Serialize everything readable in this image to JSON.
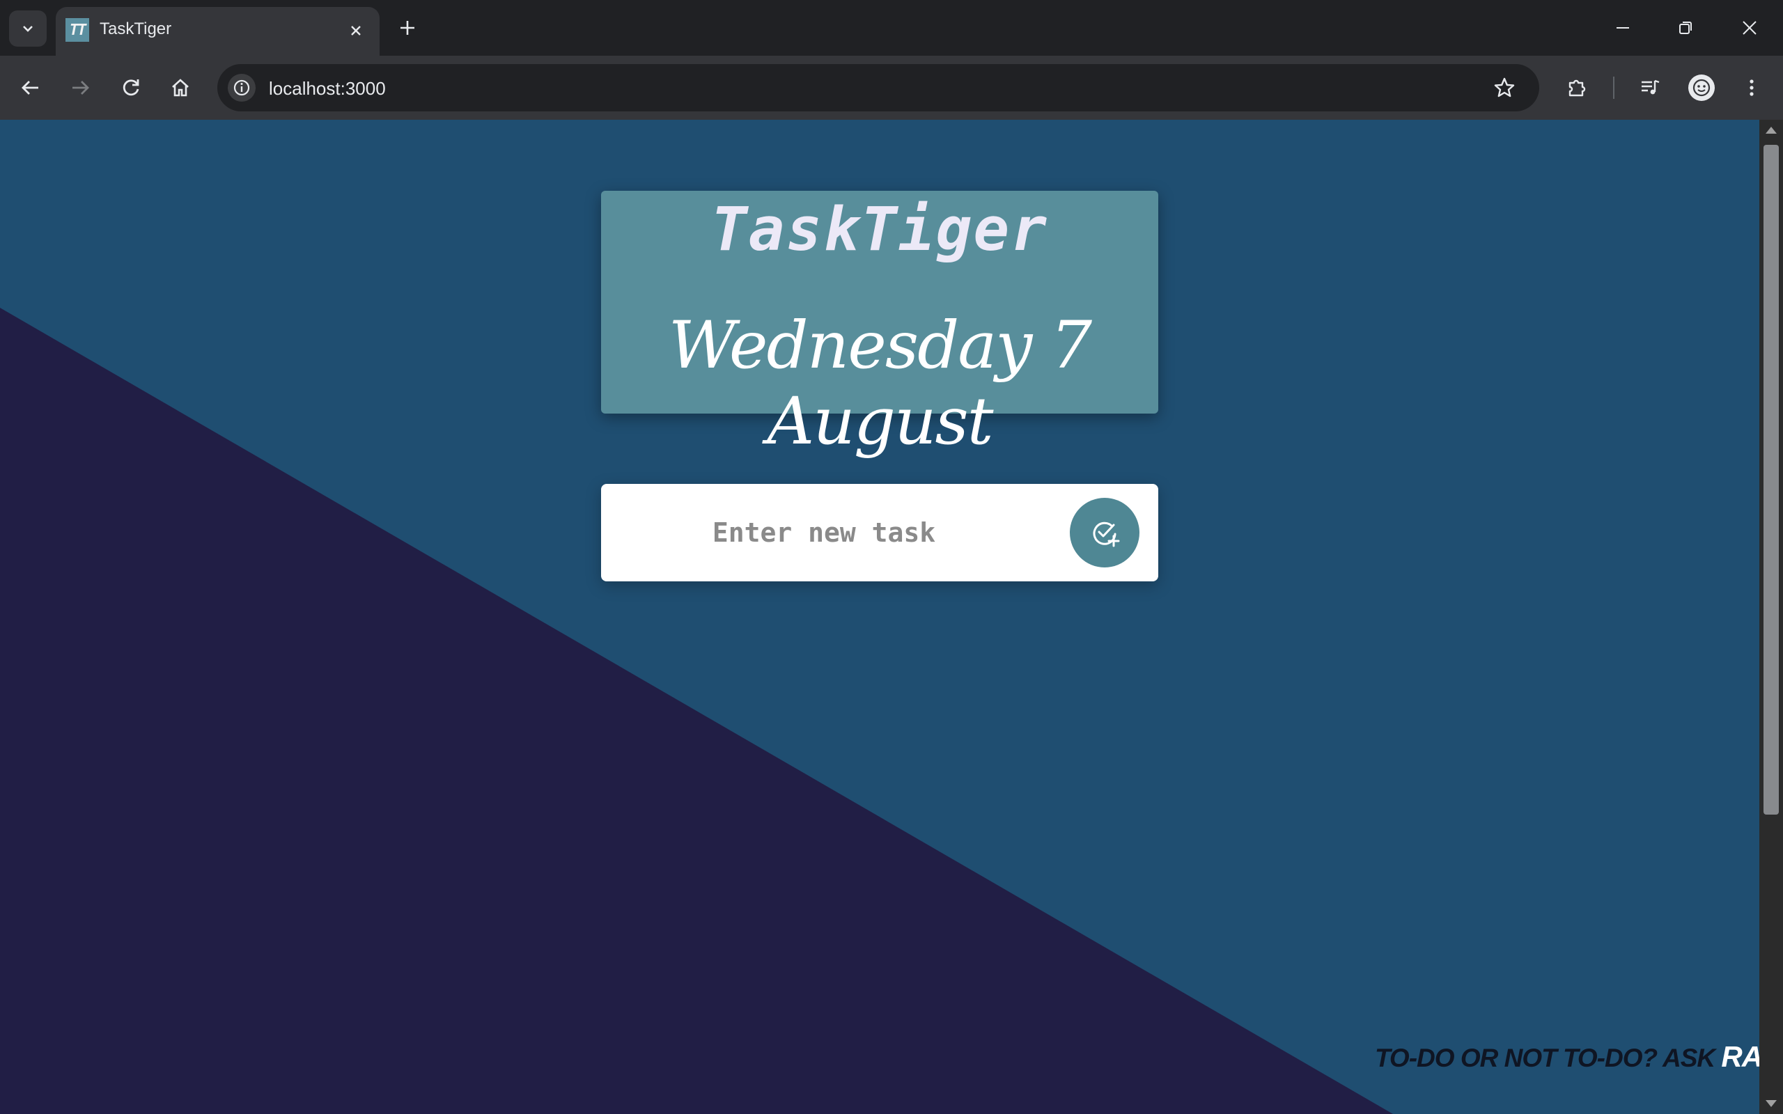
{
  "browser": {
    "tab_title": "TaskTiger",
    "favicon_text": "TT",
    "url": "localhost:3000"
  },
  "header": {
    "app_title": "TaskTiger",
    "date": "Wednesday 7 August"
  },
  "task_form": {
    "placeholder": "Enter new task",
    "value": ""
  },
  "footer": {
    "tagline": "To-do or not to-do? Ask",
    "name": "Ravi"
  },
  "colors": {
    "page_bg": "#1f4e71",
    "triangle_bg": "#211e45",
    "card_bg": "#588e9b",
    "button_bg": "#4f8794"
  }
}
